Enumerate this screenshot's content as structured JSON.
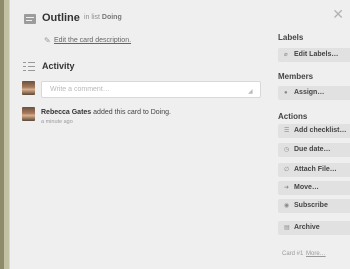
{
  "card": {
    "title": "Outline",
    "list_prefix": "in list",
    "list_name": "Doing",
    "edit_description": "Edit the card description."
  },
  "activity": {
    "title": "Activity",
    "comment_placeholder": "Write a comment…",
    "entries": [
      {
        "user": "Rebecca Gates",
        "action": "added this card to Doing.",
        "time": "a minute ago"
      }
    ]
  },
  "sidebar": {
    "labels_heading": "Labels",
    "edit_labels": "Edit Labels…",
    "members_heading": "Members",
    "assign": "Assign…",
    "actions_heading": "Actions",
    "add_checklist": "Add checklist…",
    "due_date": "Due date…",
    "attach_file": "Attach File…",
    "move": "Move…",
    "subscribe": "Subscribe",
    "archive": "Archive"
  },
  "footer": {
    "card_number": "Card #1",
    "more": "More…"
  },
  "icons": {
    "close": "close-icon",
    "title": "card-title-icon",
    "activity": "activity-list-icon",
    "edit": "pencil-icon"
  },
  "colors": {
    "backdrop": "#c3c1a3",
    "window": "#efefef",
    "button": "#e1e1e1"
  }
}
